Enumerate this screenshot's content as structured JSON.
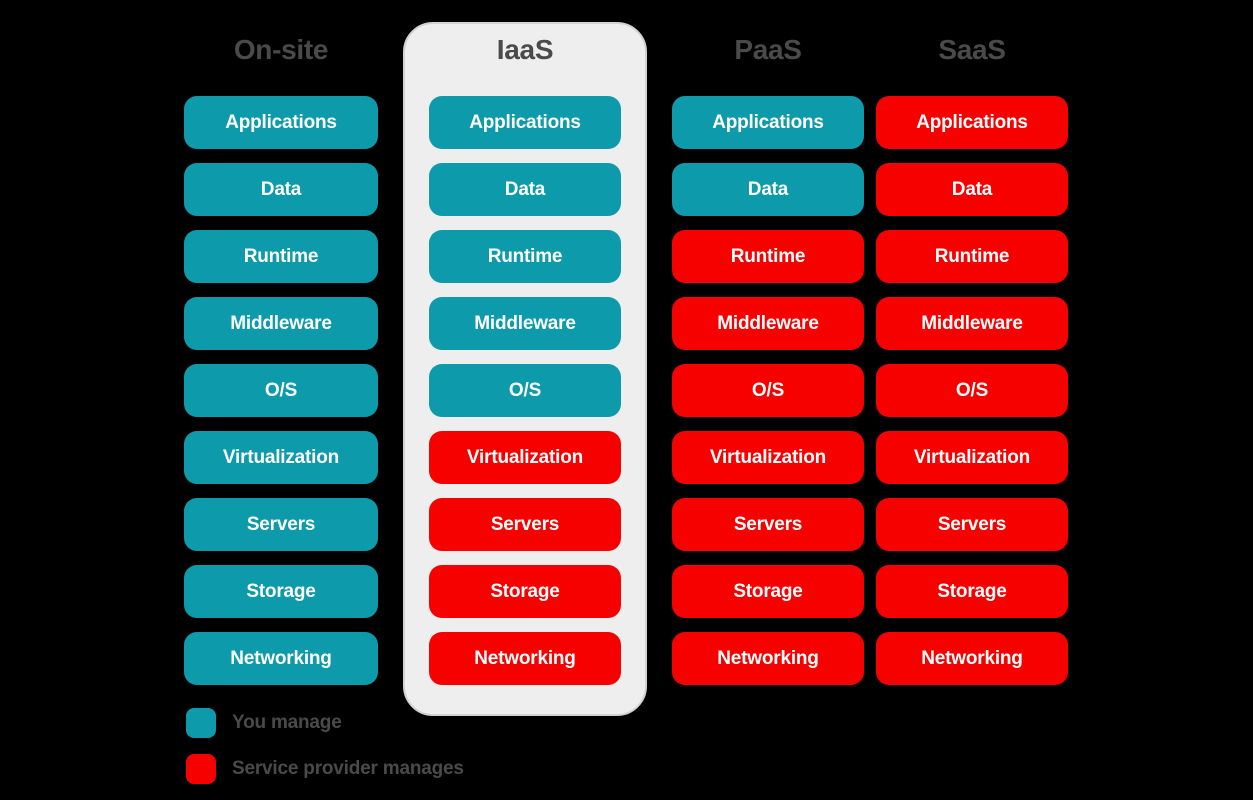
{
  "diagram": {
    "title_present": false,
    "colors": {
      "you_manage": "#0d9aab",
      "provider_manages": "#f60000",
      "header_text": "#4a4a4a",
      "panel_background": "#eeeeee",
      "panel_border": "#d2d2d2",
      "page_background": "#000000",
      "layer_text": "#ffffff"
    },
    "columns": [
      {
        "id": "on-site",
        "header": "On-site",
        "highlighted": false,
        "layers": [
          {
            "label": "Applications",
            "owner": "you"
          },
          {
            "label": "Data",
            "owner": "you"
          },
          {
            "label": "Runtime",
            "owner": "you"
          },
          {
            "label": "Middleware",
            "owner": "you"
          },
          {
            "label": "O/S",
            "owner": "you"
          },
          {
            "label": "Virtualization",
            "owner": "you"
          },
          {
            "label": "Servers",
            "owner": "you"
          },
          {
            "label": "Storage",
            "owner": "you"
          },
          {
            "label": "Networking",
            "owner": "you"
          }
        ]
      },
      {
        "id": "iaas",
        "header": "IaaS",
        "highlighted": true,
        "layers": [
          {
            "label": "Applications",
            "owner": "you"
          },
          {
            "label": "Data",
            "owner": "you"
          },
          {
            "label": "Runtime",
            "owner": "you"
          },
          {
            "label": "Middleware",
            "owner": "you"
          },
          {
            "label": "O/S",
            "owner": "you"
          },
          {
            "label": "Virtualization",
            "owner": "provider"
          },
          {
            "label": "Servers",
            "owner": "provider"
          },
          {
            "label": "Storage",
            "owner": "provider"
          },
          {
            "label": "Networking",
            "owner": "provider"
          }
        ]
      },
      {
        "id": "paas",
        "header": "PaaS",
        "highlighted": false,
        "layers": [
          {
            "label": "Applications",
            "owner": "you"
          },
          {
            "label": "Data",
            "owner": "you"
          },
          {
            "label": "Runtime",
            "owner": "provider"
          },
          {
            "label": "Middleware",
            "owner": "provider"
          },
          {
            "label": "O/S",
            "owner": "provider"
          },
          {
            "label": "Virtualization",
            "owner": "provider"
          },
          {
            "label": "Servers",
            "owner": "provider"
          },
          {
            "label": "Storage",
            "owner": "provider"
          },
          {
            "label": "Networking",
            "owner": "provider"
          }
        ]
      },
      {
        "id": "saas",
        "header": "SaaS",
        "highlighted": false,
        "layers": [
          {
            "label": "Applications",
            "owner": "provider"
          },
          {
            "label": "Data",
            "owner": "provider"
          },
          {
            "label": "Runtime",
            "owner": "provider"
          },
          {
            "label": "Middleware",
            "owner": "provider"
          },
          {
            "label": "O/S",
            "owner": "provider"
          },
          {
            "label": "Virtualization",
            "owner": "provider"
          },
          {
            "label": "Servers",
            "owner": "provider"
          },
          {
            "label": "Storage",
            "owner": "provider"
          },
          {
            "label": "Networking",
            "owner": "provider"
          }
        ]
      }
    ],
    "legend": [
      {
        "key": "you",
        "label": "You manage"
      },
      {
        "key": "provider",
        "label": "Service provider manages"
      }
    ]
  }
}
